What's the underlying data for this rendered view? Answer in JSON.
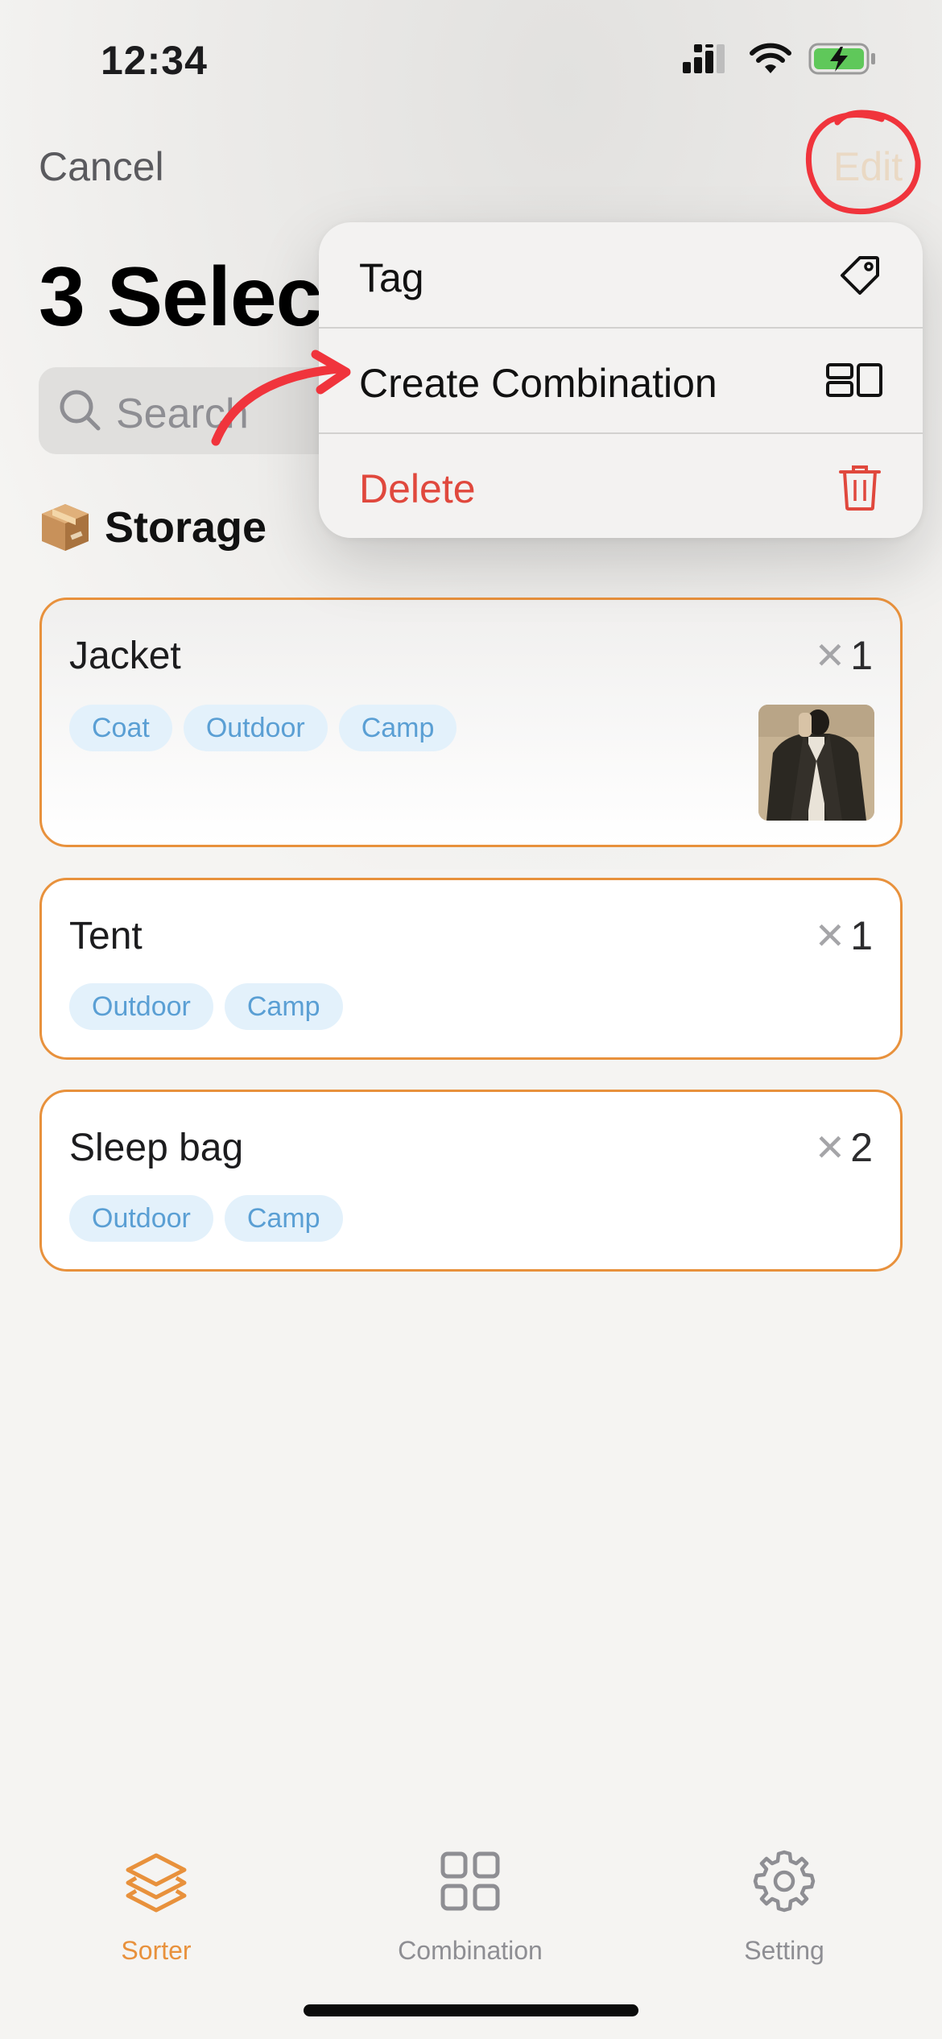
{
  "status_bar": {
    "time": "12:34"
  },
  "nav": {
    "cancel": "Cancel",
    "edit": "Edit"
  },
  "title": "3 Selec",
  "search": {
    "placeholder": "Search"
  },
  "section": {
    "emoji": "📦",
    "label": "Storage"
  },
  "items": [
    {
      "name": "Jacket",
      "qty_symbol": "✕",
      "qty": "1",
      "tags": [
        "Coat",
        "Outdoor",
        "Camp"
      ],
      "has_image": true
    },
    {
      "name": "Tent",
      "qty_symbol": "✕",
      "qty": "1",
      "tags": [
        "Outdoor",
        "Camp"
      ],
      "has_image": false
    },
    {
      "name": "Sleep bag",
      "qty_symbol": "✕",
      "qty": "2",
      "tags": [
        "Outdoor",
        "Camp"
      ],
      "has_image": false
    }
  ],
  "menu": {
    "items": [
      {
        "label": "Tag",
        "icon": "tag-icon"
      },
      {
        "label": "Create Combination",
        "icon": "combination-icon"
      },
      {
        "label": "Delete",
        "icon": "trash-icon"
      }
    ]
  },
  "tabbar": {
    "tabs": [
      {
        "label": "Sorter",
        "icon": "layers-icon",
        "active": true
      },
      {
        "label": "Combination",
        "icon": "grid-icon",
        "active": false
      },
      {
        "label": "Setting",
        "icon": "gear-icon",
        "active": false
      }
    ]
  },
  "colors": {
    "accent": "#e8913c",
    "tag_bg": "#e3f1fb",
    "tag_text": "#5a9fd4",
    "destructive": "#e0483d",
    "annotation": "#f0343c"
  }
}
